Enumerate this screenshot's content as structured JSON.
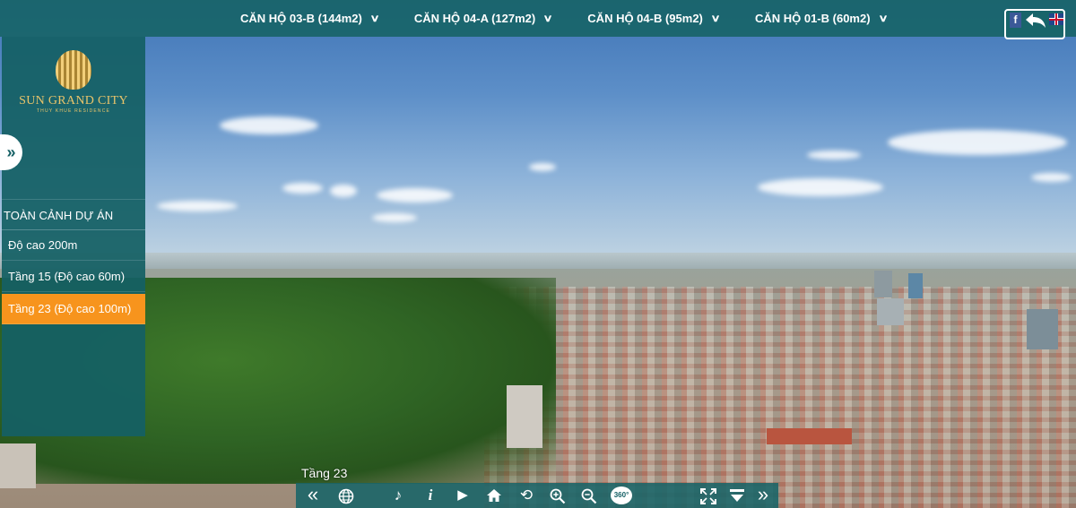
{
  "top_menu": {
    "items": [
      {
        "label": "CĂN HỘ 03-B (144m2)"
      },
      {
        "label": "CĂN HỘ 04-A (127m2)"
      },
      {
        "label": "CĂN HỘ 04-B (95m2)"
      },
      {
        "label": "CĂN HỘ 01-B (60m2)"
      }
    ],
    "chevron_icon": "chevron-down-icon"
  },
  "social": {
    "facebook_letter": "f",
    "back_icon": "back-arrow-icon",
    "language_icon": "uk-flag-icon"
  },
  "sidebar": {
    "logo": {
      "title": "SUN GRAND CITY",
      "subtitle": "THUY KHUE RESIDENCE"
    },
    "toggle_glyph": "»",
    "section_title": "TOÀN CẢNH DỰ ÁN",
    "items": [
      {
        "label": "Độ cao 200m",
        "active": false
      },
      {
        "label": "Tầng 15 (Độ cao 60m)",
        "active": false
      },
      {
        "label": "Tầng 23 (Độ cao 100m)",
        "active": true
      }
    ],
    "active_color": "#f7941d"
  },
  "viewer": {
    "floor_label": "Tầng 23",
    "controls": [
      {
        "name": "prev-scene",
        "glyph": "«"
      },
      {
        "name": "globe",
        "glyph": "🌐"
      },
      {
        "name": "music",
        "glyph": "♪"
      },
      {
        "name": "info",
        "glyph": "i"
      },
      {
        "name": "play",
        "glyph": "▶"
      },
      {
        "name": "home",
        "glyph": "⌂"
      },
      {
        "name": "rotate",
        "glyph": "⟲"
      },
      {
        "name": "zoom-in",
        "glyph": "+"
      },
      {
        "name": "zoom-out",
        "glyph": "−"
      },
      {
        "name": "view-360",
        "glyph": "360°"
      },
      {
        "name": "fullscreen",
        "glyph": "⤢"
      },
      {
        "name": "hide-bar",
        "glyph": "▼"
      },
      {
        "name": "next-scene",
        "glyph": "»"
      }
    ]
  },
  "colors": {
    "bar": "#186468",
    "accent": "#f7941d",
    "logo_gold": "#e9c46a"
  }
}
